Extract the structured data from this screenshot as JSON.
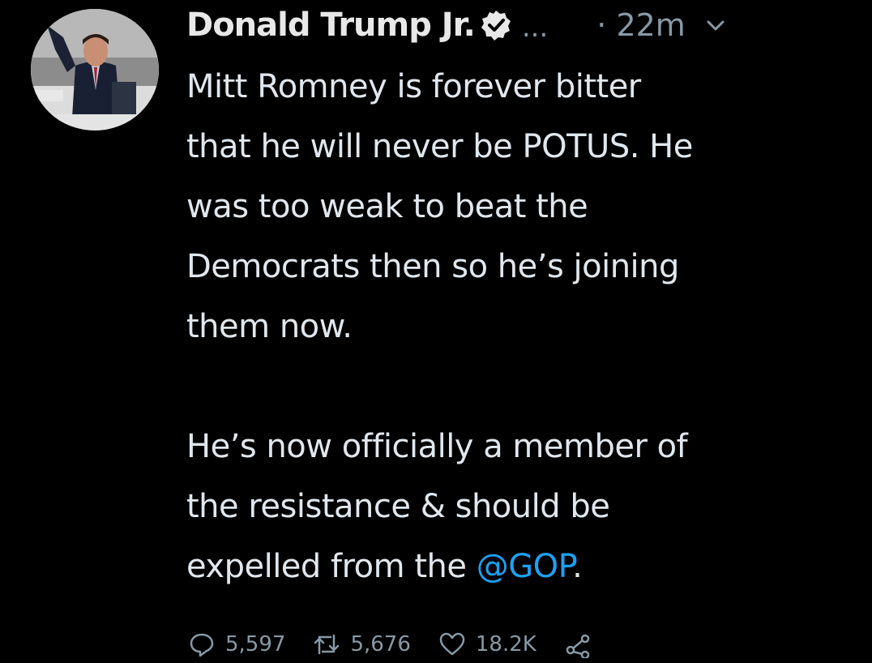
{
  "tweet": {
    "author": {
      "display_name": "Donald Trump Jr.",
      "verified_icon": "verified-badge-icon",
      "truncation": "...",
      "avatar": "profile-photo"
    },
    "timestamp": "· 22m",
    "menu_icon": "chevron-down-icon",
    "text": {
      "lines_para1": [
        "Mitt Romney is forever bitter",
        "that he will never be POTUS. He",
        "was too weak to beat the",
        "Democrats then so he’s joining",
        "them now."
      ],
      "lines_para2": [
        "He’s now officially a member of",
        "the resistance & should be"
      ],
      "last_line_prefix": "expelled from the ",
      "mention": "@GOP",
      "last_line_suffix": "."
    },
    "actions": {
      "reply": {
        "icon": "reply-icon",
        "count": "5,597"
      },
      "retweet": {
        "icon": "retweet-icon",
        "count": "5,676"
      },
      "like": {
        "icon": "heart-icon",
        "count": "18.2K"
      },
      "share": {
        "icon": "share-icon"
      }
    }
  },
  "colors": {
    "background": "#000000",
    "text": "#e1e8ed",
    "muted": "#8899a6",
    "link": "#1da1f2"
  }
}
